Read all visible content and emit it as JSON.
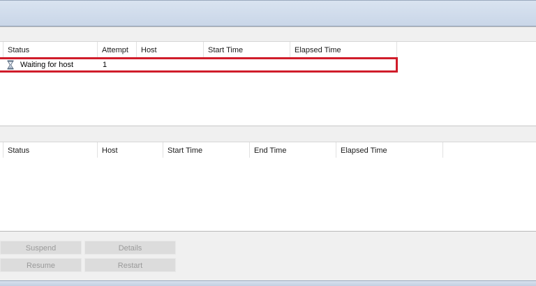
{
  "jobs_grid": {
    "columns": [
      "Status",
      "Attempt",
      "Host",
      "Start Time",
      "Elapsed Time"
    ],
    "rows": [
      {
        "status_icon": "hourglass-icon",
        "status": "Waiting for host",
        "attempt": "1",
        "host": "",
        "start_time": "",
        "elapsed_time": ""
      }
    ]
  },
  "history_grid": {
    "columns": [
      "Status",
      "Host",
      "Start Time",
      "End Time",
      "Elapsed Time"
    ],
    "rows": []
  },
  "buttons": {
    "suspend": "Suspend",
    "details": "Details",
    "resume": "Resume",
    "restart": "Restart"
  },
  "colors": {
    "highlight": "#d01c2a",
    "disabled_text": "#9a9a9a"
  }
}
